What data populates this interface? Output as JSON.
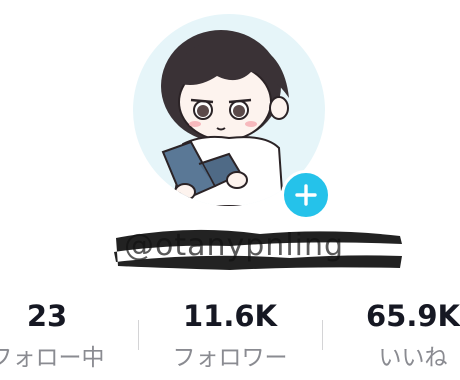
{
  "profile": {
    "username": "@otanypnling",
    "add_icon": "plus-icon",
    "accent_color": "#25c2ea"
  },
  "stats": {
    "following": {
      "value": "23",
      "label": "フォロー中"
    },
    "followers": {
      "value": "11.6K",
      "label": "フォロワー"
    },
    "likes": {
      "value": "65.9K",
      "label": "いいね"
    }
  }
}
